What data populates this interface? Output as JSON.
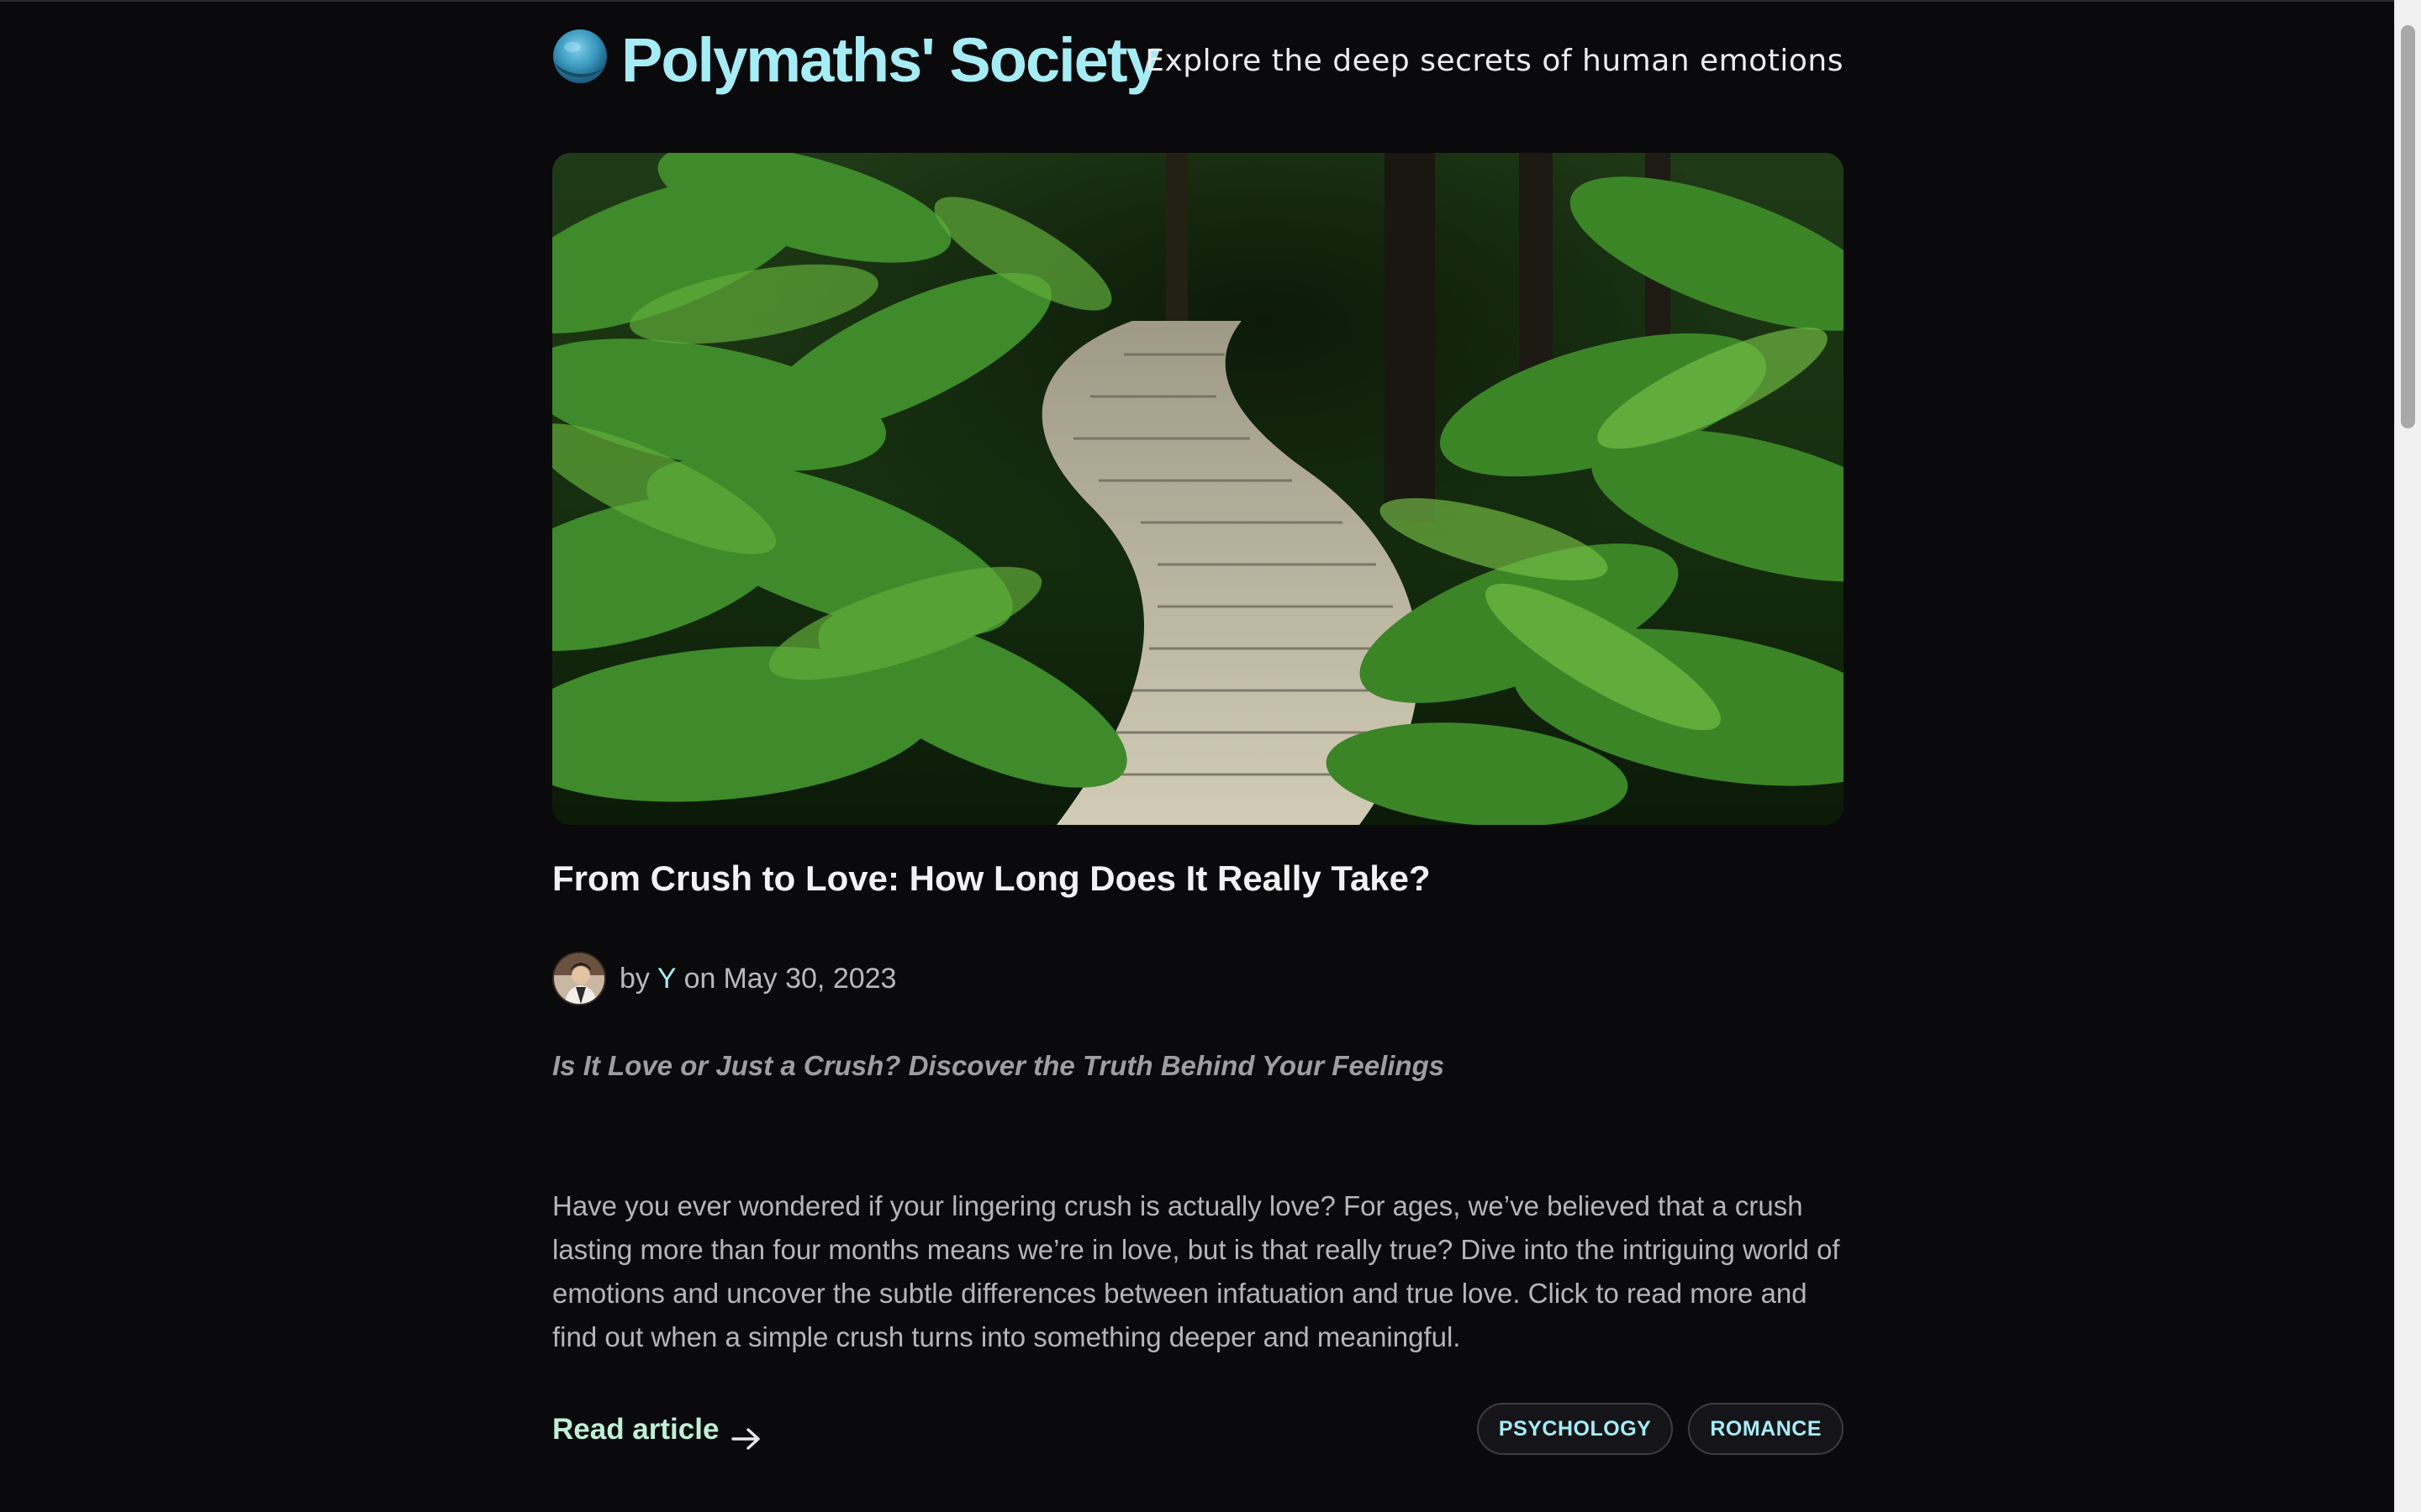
{
  "header": {
    "site_title": "Polymaths' Society",
    "tagline": "Explore the deep secrets of human emotions",
    "logo_icon": "globe-logo-icon"
  },
  "article": {
    "title": "From Crush to Love: How Long Does It Really Take?",
    "byline": {
      "by_label": "by",
      "author": "Y",
      "on_label": "on",
      "date": "May 30, 2023"
    },
    "subtitle": "Is It Love or Just a Crush? Discover the Truth Behind Your Feelings",
    "excerpt": "Have you ever wondered if your lingering crush is actually love? For ages, we’ve believed that a crush lasting more than four months means we’re in love, but is that really true? Dive into the intriguing world of emotions and uncover the subtle differences between infatuation and true love. Click to read more and find out when a simple crush turns into something deeper and meaningful.",
    "read_label": "Read article",
    "tags": [
      "PSYCHOLOGY",
      "ROMANCE"
    ]
  },
  "colors": {
    "background": "#0a0a0c",
    "accent": "#a6ecf5",
    "read_link": "#bff0d8",
    "muted_text": "#b5b5ba"
  }
}
